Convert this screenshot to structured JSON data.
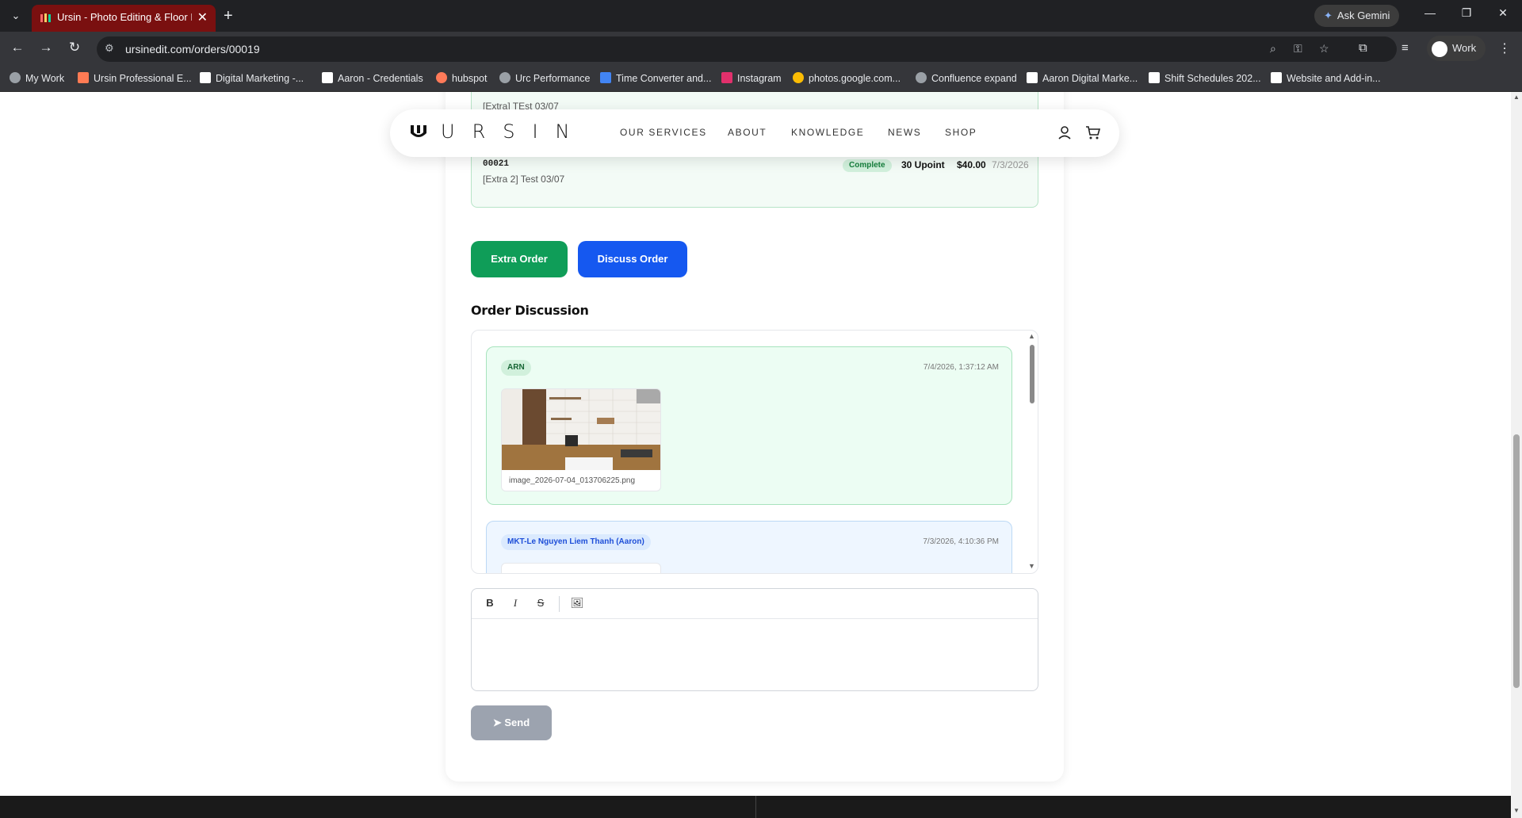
{
  "browser": {
    "tab_title": "Ursin - Photo Editing & Floor Pl",
    "url": "ursinedit.com/orders/00019",
    "ask_gemini": "Ask Gemini",
    "profile_name": "Work",
    "bookmarks": [
      "My Work",
      "Ursin Professional E...",
      "Digital Marketing -...",
      "Aaron - Credentials",
      "hubspot",
      "Urc Performance",
      "Time Converter and...",
      "Instagram",
      "photos.google.com...",
      "Confluence expand",
      "Aaron Digital Marke...",
      "Shift Schedules 202...",
      "Website and Add-in..."
    ]
  },
  "header": {
    "logo": "URSIN",
    "nav": [
      "OUR SERVICES",
      "ABOUT",
      "KNOWLEDGE",
      "NEWS",
      "SHOP"
    ]
  },
  "extra_orders": [
    {
      "id": "",
      "name": "[Extra] TEst 03/07",
      "status": "",
      "points": "",
      "price": "",
      "date": ""
    },
    {
      "id": "00021",
      "name": "[Extra 2] Test 03/07",
      "status": "Complete",
      "points": "30 Upoint",
      "price": "$40.00",
      "date": "7/3/2026"
    }
  ],
  "actions": {
    "extra_order": "Extra Order",
    "discuss_order": "Discuss Order"
  },
  "discussion": {
    "title": "Order Discussion",
    "messages": [
      {
        "author": "ARN",
        "time": "7/4/2026, 1:37:12 AM",
        "attachment": "image_2026-07-04_013706225.png"
      },
      {
        "author": "MKT-Le Nguyen Liem Thanh (Aaron)",
        "time": "7/3/2026, 4:10:36 PM"
      }
    ]
  },
  "editor": {
    "tools": [
      "bold-icon",
      "italic-icon",
      "strikethrough-icon",
      "image-icon"
    ],
    "send": "Send"
  }
}
